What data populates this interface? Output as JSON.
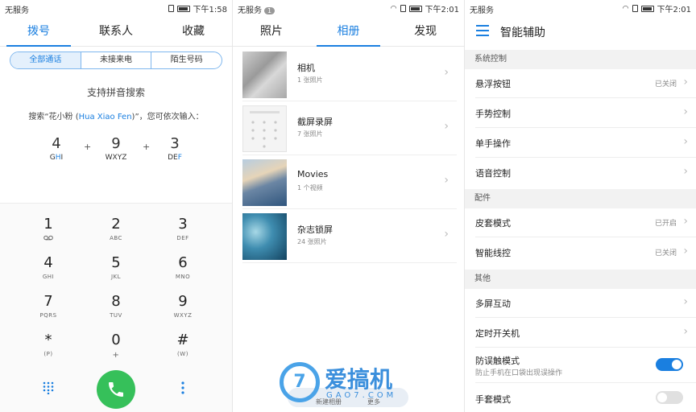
{
  "colors": {
    "accent": "#1a7fe0",
    "call": "#36c05a",
    "toggle_off": "#e0e0e0"
  },
  "dialer": {
    "status": {
      "carrier": "无服务",
      "time": "下午1:58"
    },
    "tabs": [
      "拨号",
      "联系人",
      "收藏"
    ],
    "filters": [
      "全部通话",
      "未接来电",
      "陌生号码"
    ],
    "pinyin_title": "支持拼音搜索",
    "pinyin_hint_prefix": "搜索“花小粉 (",
    "pinyin_hint_name": "Hua Xiao Fen",
    "pinyin_hint_suffix": ")”，您可依次输入：",
    "sequence": [
      {
        "digit": "4",
        "pre": "G",
        "hi": "H",
        "post": "I"
      },
      {
        "digit": "9",
        "pre": "WX",
        "hi": "",
        "post": "YZ"
      },
      {
        "digit": "3",
        "pre": "DE",
        "hi": "F",
        "post": ""
      }
    ],
    "plus": "+",
    "keys": [
      {
        "n": "1",
        "l": "voicemail-icon"
      },
      {
        "n": "2",
        "l": "ABC"
      },
      {
        "n": "3",
        "l": "DEF"
      },
      {
        "n": "4",
        "l": "GHI"
      },
      {
        "n": "5",
        "l": "JKL"
      },
      {
        "n": "6",
        "l": "MNO"
      },
      {
        "n": "7",
        "l": "PQRS"
      },
      {
        "n": "8",
        "l": "TUV"
      },
      {
        "n": "9",
        "l": "WXYZ"
      },
      {
        "n": "*",
        "l": "(P)"
      },
      {
        "n": "0",
        "l": "+"
      },
      {
        "n": "#",
        "l": "(W)"
      }
    ]
  },
  "gallery": {
    "status": {
      "carrier": "无服务",
      "badge": "1",
      "time": "下午2:01"
    },
    "tabs": [
      "照片",
      "相册",
      "发现"
    ],
    "albums": [
      {
        "name": "相机",
        "count": "1 张照片"
      },
      {
        "name": "截屏录屏",
        "count": "7 张照片"
      },
      {
        "name": "Movies",
        "count": "1 个视频"
      },
      {
        "name": "杂志锁屏",
        "count": "24 张照片"
      }
    ],
    "new_album": "新建相册",
    "more": "更多",
    "watermark_text": "爱搞机",
    "watermark_sub": "GAO7.COM",
    "watermark_logo": "7"
  },
  "settings": {
    "status": {
      "carrier": "无服务",
      "time": "下午2:01"
    },
    "title": "智能辅助",
    "sections": [
      {
        "header": "系统控制",
        "rows": [
          {
            "label": "悬浮按钮",
            "value": "已关闭"
          },
          {
            "label": "手势控制",
            "value": ""
          },
          {
            "label": "单手操作",
            "value": ""
          },
          {
            "label": "语音控制",
            "value": ""
          }
        ]
      },
      {
        "header": "配件",
        "rows": [
          {
            "label": "皮套模式",
            "value": "已开启"
          },
          {
            "label": "智能线控",
            "value": "已关闭"
          }
        ]
      },
      {
        "header": "其他",
        "rows": [
          {
            "label": "多屏互动",
            "value": ""
          },
          {
            "label": "定时开关机",
            "value": ""
          }
        ]
      }
    ],
    "toggles": [
      {
        "label": "防误触模式",
        "sub": "防止手机在口袋出现误操作",
        "on": true
      },
      {
        "label": "手套模式",
        "sub": "",
        "on": false
      }
    ]
  }
}
